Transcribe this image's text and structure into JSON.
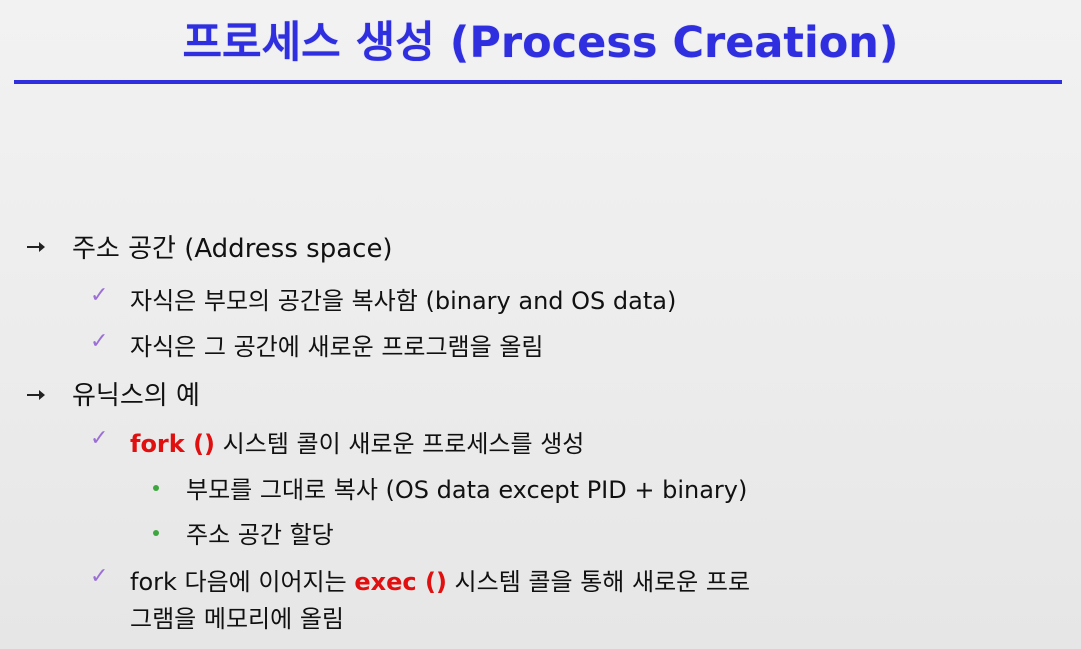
{
  "slide": {
    "title": "프로세스 생성 (Process Creation)",
    "items": [
      {
        "text": "주소 공간 (Address space)",
        "subitems": [
          {
            "text": "자식은 부모의 공간을 복사함 (binary and OS data)"
          },
          {
            "text": "자식은 그 공간에 새로운 프로그램을 올림"
          }
        ]
      },
      {
        "text": "유닉스의 예",
        "subitems": [
          {
            "highlight": "fork ()",
            "rest": " 시스템 콜이 새로운 프로세스를 생성",
            "subitems": [
              {
                "text": "부모를 그대로 복사 (OS data except PID  +  binary)"
              },
              {
                "text": "주소 공간 할당"
              }
            ]
          },
          {
            "prefix": "fork 다음에 이어지는 ",
            "highlight": "exec ()",
            "rest": " 시스템 콜을 통해 새로운 프로",
            "continuation": "그램을 메모리에 올림"
          }
        ]
      }
    ]
  },
  "colors": {
    "title": "#2f2fe0",
    "rule": "#2f2fe0",
    "highlight": "#e01010",
    "check": "#9b6fd6",
    "dot": "#3ea63e"
  }
}
